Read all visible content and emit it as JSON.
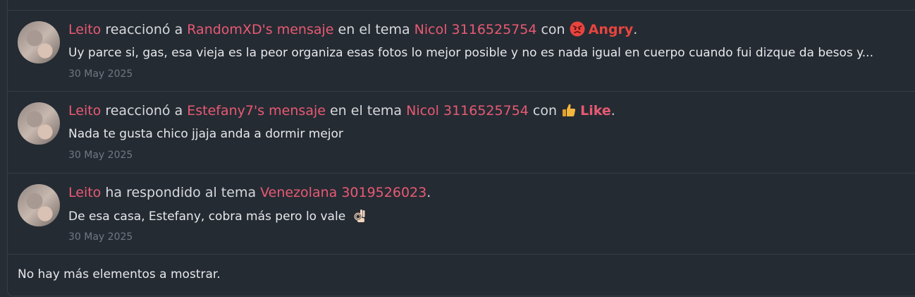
{
  "items": [
    {
      "user": "Leito",
      "action": "reaccionó a",
      "target": "RandomXD's mensaje",
      "in_text": "en el tema",
      "thread": "Nicol 3116525754",
      "with_text": "con",
      "reaction_icon": "angry-face-icon",
      "reaction": "Angry",
      "snippet": "Uy parce si, gas, esa vieja es la peor organiza esas fotos lo mejor posible y no es nada igual en cuerpo cuando fui dizque da besos y...",
      "date": "30 May 2025"
    },
    {
      "user": "Leito",
      "action": "reaccionó a",
      "target": "Estefany7's mensaje",
      "in_text": "en el tema",
      "thread": "Nicol 3116525754",
      "with_text": "con",
      "reaction_icon": "thumbs-up-icon",
      "reaction": "Like",
      "snippet": "Nada te gusta chico jjaja anda a dormir mejor",
      "date": "30 May 2025"
    },
    {
      "user": "Leito",
      "action": "ha respondido al tema",
      "thread": "Venezolana 3019526023",
      "snippet": "De esa casa, Estefany, cobra más pero lo vale",
      "snippet_icon": "ok-hand-icon",
      "date": "30 May 2025"
    }
  ],
  "footer": {
    "text": "No hay más elementos a mostrar."
  },
  "colors": {
    "link": "#e85a73",
    "angry": "#e8453f",
    "background": "#252b33"
  }
}
